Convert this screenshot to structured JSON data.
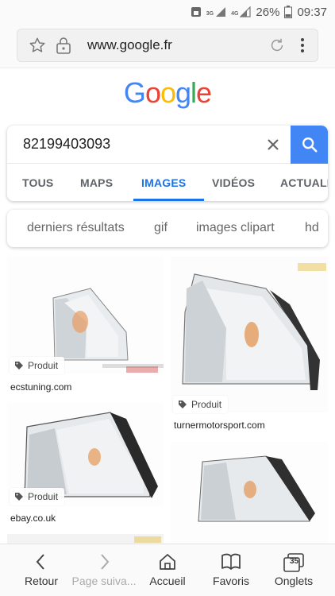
{
  "status_bar": {
    "network_1": "3G",
    "network_2": "4G",
    "battery": "26%",
    "time": "09:37"
  },
  "browser": {
    "url": "www.google.fr"
  },
  "google_logo": [
    "G",
    "o",
    "o",
    "g",
    "l",
    "e"
  ],
  "search": {
    "query": "82199403093",
    "tabs": [
      "TOUS",
      "MAPS",
      "IMAGES",
      "VIDÉOS",
      "ACTUALI"
    ],
    "active_tab": "IMAGES"
  },
  "chips": [
    "derniers résultats",
    "gif",
    "images clipart",
    "hd"
  ],
  "results": [
    {
      "badge": "Produit",
      "source": "ecstuning.com"
    },
    {
      "badge": "Produit",
      "source": "turnermotorsport.com"
    },
    {
      "badge": "Produit",
      "source": "ebay.co.uk"
    },
    {
      "badge": "",
      "source": ""
    }
  ],
  "bottom_nav": {
    "back": "Retour",
    "forward": "Page suiva...",
    "home": "Accueil",
    "bookmarks": "Favoris",
    "tabs": "Onglets",
    "tab_count": "35"
  },
  "colors": {
    "google_blue": "#4285f4",
    "google_red": "#ea4335",
    "google_yellow": "#fbbc05",
    "google_green": "#34a853",
    "active_tab": "#1a73e8"
  }
}
